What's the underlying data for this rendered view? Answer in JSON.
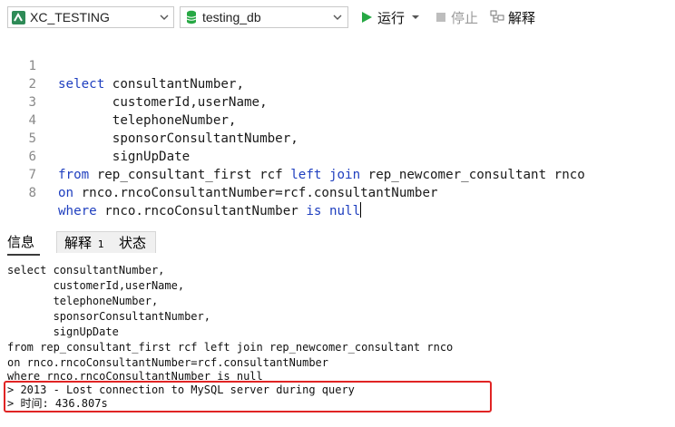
{
  "toolbar": {
    "connection": "XC_TESTING",
    "database": "testing_db",
    "run_label": "运行",
    "stop_label": "停止",
    "explain_label": "解释"
  },
  "editor": {
    "lines": [
      {
        "num": "1",
        "text": "select consultantNumber,"
      },
      {
        "num": "2",
        "text": "       customerId,userName,"
      },
      {
        "num": "3",
        "text": "       telephoneNumber,"
      },
      {
        "num": "4",
        "text": "       sponsorConsultantNumber,"
      },
      {
        "num": "5",
        "text": "       signUpDate"
      },
      {
        "num": "6",
        "text": "from rep_consultant_first rcf left join rep_newcomer_consultant rnco"
      },
      {
        "num": "7",
        "text": "on rnco.rncoConsultantNumber=rcf.consultantNumber"
      },
      {
        "num": "8",
        "text": "where rnco.rncoConsultantNumber is null"
      }
    ]
  },
  "results": {
    "tabs": [
      {
        "label": "信息",
        "active": true
      },
      {
        "label": "解释",
        "badge": "1"
      },
      {
        "label": "状态"
      }
    ],
    "messages": [
      "select consultantNumber,",
      "       customerId,userName,",
      "       telephoneNumber,",
      "       sponsorConsultantNumber,",
      "       signUpDate",
      "from rep_consultant_first rcf left join rep_newcomer_consultant rnco",
      "on rnco.rncoConsultantNumber=rcf.consultantNumber",
      "where rnco.rncoConsultantNumber is null",
      "> 2013 - Lost connection to MySQL server during query",
      "> 时间: 436.807s"
    ]
  },
  "colors": {
    "keyword": "#1f3fbf",
    "run_green": "#27a844",
    "highlight_red": "#e02424",
    "connection_green": "#2e8b57"
  }
}
